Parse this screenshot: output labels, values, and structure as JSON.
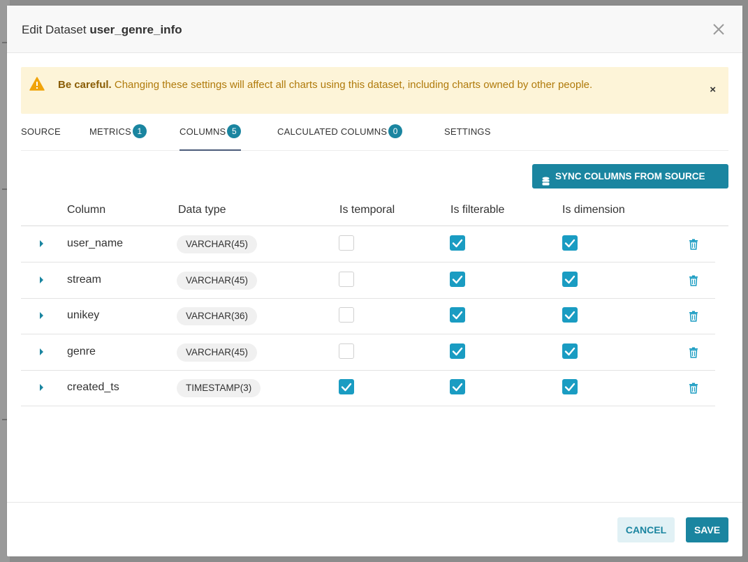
{
  "modal": {
    "title_prefix": "Edit Dataset",
    "dataset_name": "user_genre_info"
  },
  "alert": {
    "strong": "Be careful.",
    "message": "Changing these settings will affect all charts using this dataset, including charts owned by other people."
  },
  "tabs": [
    {
      "label": "SOURCE",
      "count": null,
      "active": false
    },
    {
      "label": "METRICS",
      "count": "1",
      "active": false
    },
    {
      "label": "COLUMNS",
      "count": "5",
      "active": true
    },
    {
      "label": "CALCULATED COLUMNS",
      "count": "0",
      "active": false
    },
    {
      "label": "SETTINGS",
      "count": null,
      "active": false
    }
  ],
  "sync_button": "SYNC COLUMNS FROM SOURCE",
  "table": {
    "headers": {
      "column": "Column",
      "data_type": "Data type",
      "is_temporal": "Is temporal",
      "is_filterable": "Is filterable",
      "is_dimension": "Is dimension"
    },
    "rows": [
      {
        "name": "user_name",
        "type": "VARCHAR(45)",
        "temporal": false,
        "filterable": true,
        "dimension": true
      },
      {
        "name": "stream",
        "type": "VARCHAR(45)",
        "temporal": false,
        "filterable": true,
        "dimension": true
      },
      {
        "name": "unikey",
        "type": "VARCHAR(36)",
        "temporal": false,
        "filterable": true,
        "dimension": true
      },
      {
        "name": "genre",
        "type": "VARCHAR(45)",
        "temporal": false,
        "filterable": true,
        "dimension": true
      },
      {
        "name": "created_ts",
        "type": "TIMESTAMP(3)",
        "temporal": true,
        "filterable": true,
        "dimension": true
      }
    ]
  },
  "footer": {
    "cancel": "CANCEL",
    "save": "SAVE"
  },
  "colors": {
    "primary": "#1a85a0",
    "checkbox": "#1a9cc2",
    "alert_bg": "#fdf4d8",
    "alert_text": "#b07a0b",
    "warning_icon": "#f0a30a"
  }
}
